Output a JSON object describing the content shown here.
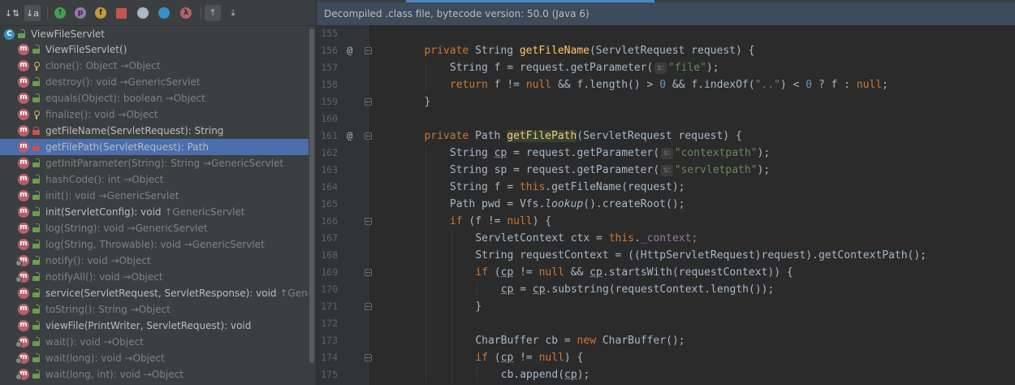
{
  "toolbar": {
    "buttons": [
      {
        "name": "sort-by-visibility-icon",
        "glyph": "↓⇅",
        "active": false
      },
      {
        "name": "sort-alphabetically-icon",
        "glyph": "↓a",
        "active": true
      },
      {
        "name": "show-inherited-icon",
        "glyph": "↑",
        "color": "#499c54"
      },
      {
        "name": "show-properties-icon",
        "glyph": "p",
        "color": "#9876aa"
      },
      {
        "name": "show-fields-icon",
        "glyph": "f",
        "color": "#c49a3c"
      },
      {
        "name": "show-non-public-icon",
        "glyph": "",
        "color": "#c75450"
      },
      {
        "name": "show-anonymous-classes-icon",
        "glyph": "",
        "color": "#a9b7c6"
      },
      {
        "name": "show-lambdas-icon",
        "glyph": "",
        "color": "#3592c4"
      },
      {
        "name": "show-lambdas-lambda-icon",
        "glyph": "λ",
        "color": "#b55f6c"
      },
      {
        "name": "autoscroll-to-source-icon",
        "glyph": "⤒",
        "active": true
      },
      {
        "name": "autoscroll-from-source-icon",
        "glyph": "⤓"
      }
    ]
  },
  "structure": {
    "root": {
      "icon": "C",
      "label": "ViewFileServlet"
    },
    "items": [
      {
        "label": "ViewFileServlet()",
        "suffix": "",
        "vis": "pub",
        "inherited": false
      },
      {
        "label": "clone(): Object",
        "suffix": " →Object",
        "vis": "prot",
        "inherited": true
      },
      {
        "label": "destroy(): void",
        "suffix": " →GenericServlet",
        "vis": "pub",
        "inherited": true
      },
      {
        "label": "equals(Object): boolean",
        "suffix": " →Object",
        "vis": "pub",
        "inherited": true
      },
      {
        "label": "finalize(): void",
        "suffix": " →Object",
        "vis": "prot",
        "inherited": true
      },
      {
        "label": "getFileName(ServletRequest): String",
        "suffix": "",
        "vis": "priv",
        "inherited": false
      },
      {
        "label": "getFilePath(ServletRequest): Path",
        "suffix": "",
        "vis": "priv",
        "inherited": false,
        "selected": true
      },
      {
        "label": "getInitParameter(String): String",
        "suffix": " →GenericServlet",
        "vis": "pub",
        "inherited": true
      },
      {
        "label": "hashCode(): int",
        "suffix": " →Object",
        "vis": "pub",
        "inherited": true
      },
      {
        "label": "init(): void",
        "suffix": " →GenericServlet",
        "vis": "pub",
        "inherited": true
      },
      {
        "label": "init(ServletConfig): void",
        "suffix": " ↑GenericServlet",
        "vis": "pub",
        "inherited": false
      },
      {
        "label": "log(String): void",
        "suffix": " →GenericServlet",
        "vis": "pub",
        "inherited": true
      },
      {
        "label": "log(String, Throwable): void",
        "suffix": " →GenericServlet",
        "vis": "pub",
        "inherited": true
      },
      {
        "label": "notify(): void",
        "suffix": " →Object",
        "vis": "pub",
        "inherited": true,
        "overlay": true
      },
      {
        "label": "notifyAll(): void",
        "suffix": " →Object",
        "vis": "pub",
        "inherited": true,
        "overlay": true
      },
      {
        "label": "service(ServletRequest, ServletResponse): void",
        "suffix": " ↑GenericServlet",
        "vis": "pub",
        "inherited": false
      },
      {
        "label": "toString(): String",
        "suffix": " →Object",
        "vis": "pub",
        "inherited": true
      },
      {
        "label": "viewFile(PrintWriter, ServletRequest): void",
        "suffix": "",
        "vis": "pub",
        "inherited": false
      },
      {
        "label": "wait(): void",
        "suffix": " →Object",
        "vis": "pub",
        "inherited": true,
        "overlay": true
      },
      {
        "label": "wait(long): void",
        "suffix": " →Object",
        "vis": "pub",
        "inherited": true,
        "overlay": true
      },
      {
        "label": "wait(long, int): void",
        "suffix": " →Object",
        "vis": "pub",
        "inherited": true,
        "overlay": true
      }
    ]
  },
  "editor": {
    "banner": "Decompiled .class file, bytecode version: 50.0 (Java 6)",
    "lines": [
      {
        "n": "155",
        "at": false,
        "fold": false,
        "tokens": []
      },
      {
        "n": "156",
        "at": true,
        "fold": true,
        "indent": 1,
        "tokens": [
          [
            "k",
            "private "
          ],
          [
            "",
            "String "
          ],
          [
            "fn",
            "getFileName"
          ],
          [
            "",
            "(ServletRequest request) {"
          ]
        ]
      },
      {
        "n": "157",
        "at": false,
        "fold": false,
        "indent": 2,
        "tokens": [
          [
            "",
            "String f = request.getParameter("
          ],
          [
            "hint",
            "s:"
          ],
          [
            "s",
            "\"file\""
          ],
          [
            "",
            ");"
          ]
        ]
      },
      {
        "n": "158",
        "at": false,
        "fold": false,
        "indent": 2,
        "tokens": [
          [
            "k",
            "return "
          ],
          [
            "",
            "f != "
          ],
          [
            "k",
            "null "
          ],
          [
            "",
            "&& f.length() > "
          ],
          [
            "n",
            "0 "
          ],
          [
            "",
            "&& f.indexOf("
          ],
          [
            "s",
            "\"..\""
          ],
          [
            "",
            ") < "
          ],
          [
            "n",
            "0 "
          ],
          [
            "",
            "? f : "
          ],
          [
            "k",
            "null"
          ],
          [
            "",
            ";"
          ]
        ]
      },
      {
        "n": "159",
        "at": false,
        "fold": true,
        "indent": 1,
        "tokens": [
          [
            "",
            "}"
          ]
        ]
      },
      {
        "n": "160",
        "at": false,
        "fold": false,
        "tokens": []
      },
      {
        "n": "161",
        "at": true,
        "fold": true,
        "indent": 1,
        "tokens": [
          [
            "k",
            "private "
          ],
          [
            "",
            "Path "
          ],
          [
            "fnh",
            "getFilePath"
          ],
          [
            "",
            "(ServletRequest request) {"
          ]
        ]
      },
      {
        "n": "162",
        "at": false,
        "fold": false,
        "indent": 2,
        "tokens": [
          [
            "",
            "String "
          ],
          [
            "u",
            "cp"
          ],
          [
            "",
            " = request.getParameter("
          ],
          [
            "hint",
            "s:"
          ],
          [
            "s",
            "\"contextpath\""
          ],
          [
            "",
            ");"
          ]
        ]
      },
      {
        "n": "163",
        "at": false,
        "fold": false,
        "indent": 2,
        "tokens": [
          [
            "",
            "String sp = request.getParameter("
          ],
          [
            "hint",
            "s:"
          ],
          [
            "s",
            "\"servletpath\""
          ],
          [
            "",
            ");"
          ]
        ]
      },
      {
        "n": "164",
        "at": false,
        "fold": false,
        "indent": 2,
        "tokens": [
          [
            "",
            "String f = "
          ],
          [
            "k",
            "this"
          ],
          [
            "",
            ".getFileName(request);"
          ]
        ]
      },
      {
        "n": "165",
        "at": false,
        "fold": false,
        "indent": 2,
        "tokens": [
          [
            "",
            "Path pwd = Vfs."
          ],
          [
            "it",
            "lookup"
          ],
          [
            "",
            "().createRoot();"
          ]
        ]
      },
      {
        "n": "166",
        "at": false,
        "fold": true,
        "indent": 2,
        "tokens": [
          [
            "k",
            "if "
          ],
          [
            "",
            "(f != "
          ],
          [
            "k",
            "null"
          ],
          [
            "",
            ") {"
          ]
        ]
      },
      {
        "n": "167",
        "at": false,
        "fold": false,
        "indent": 3,
        "tokens": [
          [
            "",
            "ServletContext ctx = "
          ],
          [
            "k",
            "this"
          ],
          [
            "",
            "."
          ],
          [
            "f",
            "_context"
          ],
          [
            "k",
            ";"
          ]
        ]
      },
      {
        "n": "168",
        "at": false,
        "fold": false,
        "indent": 3,
        "tokens": [
          [
            "",
            "String requestContext = ((HttpServletRequest)request).getContextPath();"
          ]
        ]
      },
      {
        "n": "169",
        "at": false,
        "fold": true,
        "indent": 3,
        "tokens": [
          [
            "k",
            "if "
          ],
          [
            "",
            "("
          ],
          [
            "u",
            "cp"
          ],
          [
            "",
            " != "
          ],
          [
            "k",
            "null "
          ],
          [
            "",
            "&& "
          ],
          [
            "u",
            "cp"
          ],
          [
            "",
            ".startsWith(requestContext)) {"
          ]
        ]
      },
      {
        "n": "170",
        "at": false,
        "fold": false,
        "indent": 4,
        "tokens": [
          [
            "u",
            "cp"
          ],
          [
            "",
            " = "
          ],
          [
            "u",
            "cp"
          ],
          [
            "",
            ".substring(requestContext.length());"
          ]
        ]
      },
      {
        "n": "171",
        "at": false,
        "fold": true,
        "indent": 3,
        "tokens": [
          [
            "",
            "}"
          ]
        ]
      },
      {
        "n": "172",
        "at": false,
        "fold": false,
        "tokens": []
      },
      {
        "n": "173",
        "at": false,
        "fold": false,
        "indent": 3,
        "tokens": [
          [
            "",
            "CharBuffer cb = "
          ],
          [
            "k",
            "new "
          ],
          [
            "",
            "CharBuffer();"
          ]
        ]
      },
      {
        "n": "174",
        "at": false,
        "fold": true,
        "indent": 3,
        "tokens": [
          [
            "k",
            "if "
          ],
          [
            "",
            "("
          ],
          [
            "u",
            "cp"
          ],
          [
            "",
            " != "
          ],
          [
            "k",
            "null"
          ],
          [
            "",
            ") {"
          ]
        ]
      },
      {
        "n": "175",
        "at": false,
        "fold": false,
        "indent": 4,
        "tokens": [
          [
            "",
            "cb.append("
          ],
          [
            "u",
            "cp"
          ],
          [
            "",
            ");"
          ]
        ]
      }
    ]
  }
}
